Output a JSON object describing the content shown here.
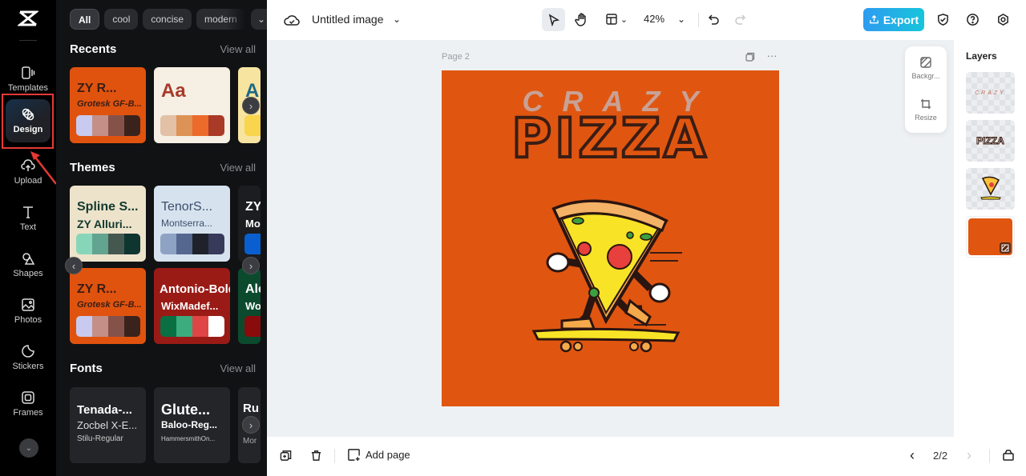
{
  "rail": {
    "items": [
      {
        "label": "Templates",
        "icon": "templates-icon"
      },
      {
        "label": "Design",
        "icon": "design-icon",
        "active": true
      },
      {
        "label": "Upload",
        "icon": "upload-icon"
      },
      {
        "label": "Text",
        "icon": "text-icon"
      },
      {
        "label": "Shapes",
        "icon": "shapes-icon"
      },
      {
        "label": "Photos",
        "icon": "photos-icon"
      },
      {
        "label": "Stickers",
        "icon": "stickers-icon"
      },
      {
        "label": "Frames",
        "icon": "frames-icon"
      }
    ]
  },
  "panel": {
    "chips": [
      "All",
      "cool",
      "concise",
      "modern"
    ],
    "recents": {
      "title": "Recents",
      "view_all": "View all",
      "cards": [
        {
          "t1": "ZY R...",
          "t2": "Grotesk GF-B...",
          "bg": "#e0530f",
          "fg": "#3a1d14",
          "palette": [
            "#c8cbef",
            "#c48f86",
            "#85524a",
            "#3a231d"
          ]
        },
        {
          "t1": "Aa",
          "bg": "#f5efe4",
          "fg": "#a83a2a",
          "palette": [
            "#e2c1a6",
            "#dd9256",
            "#ec6a2a",
            "#a93a27"
          ]
        },
        {
          "t1": "A",
          "bg": "#f8e4a1",
          "fg": "#1e6a84",
          "palette": [
            "#f9d44d"
          ]
        }
      ]
    },
    "themes": {
      "title": "Themes",
      "view_all": "View all",
      "cards": [
        {
          "t1": "Spline S...",
          "t2": "ZY Alluri...",
          "bg": "#ede3cb",
          "fg": "#12392f",
          "palette": [
            "#88d6b9",
            "#62a48f",
            "#45584f",
            "#0f3531"
          ]
        },
        {
          "t1": "TenorS...",
          "t2": "Montserra...",
          "bg": "#d6e3ef",
          "fg": "#3d4e6b",
          "palette": [
            "#8ea3c4",
            "#56678f",
            "#20222b",
            "#383a5a"
          ]
        },
        {
          "t1": "ZY",
          "t2": "Mo",
          "bg": "#1b1d20",
          "fg": "#ffffff",
          "palette": [
            "#0a5fd0"
          ]
        },
        {
          "t1": "ZY R...",
          "t2": "Grotesk GF-B...",
          "bg": "#e0530f",
          "fg": "#3a1d14",
          "palette": [
            "#c8cbef",
            "#c48f86",
            "#85524a",
            "#3a231d"
          ]
        },
        {
          "t1": "Antonio-Bold",
          "t2": "WixMadef...",
          "bg": "#9a1b16",
          "fg": "#ffffff",
          "palette": [
            "#0b6f44",
            "#3bac7e",
            "#e04546",
            "#ffffff"
          ]
        },
        {
          "t1": "Ale",
          "t2": "Wo",
          "bg": "#0c4a2e",
          "fg": "#ffffff",
          "palette": [
            "#8a0b0b"
          ]
        }
      ]
    },
    "fonts": {
      "title": "Fonts",
      "view_all": "View all",
      "cards": [
        {
          "t1": "Tenada-...",
          "t2": "Zocbel X-E...",
          "t3": "Stilu-Regular"
        },
        {
          "t1": "Glute...",
          "t2": "Baloo-Reg...",
          "t3": "HammersmithOn..."
        },
        {
          "t1": "Ru",
          "t3": "Mor"
        }
      ]
    }
  },
  "topbar": {
    "title": "Untitled image",
    "zoom": "42%",
    "export_label": "Export"
  },
  "canvas": {
    "page_label": "Page 2",
    "artboard_bg": "#e05610",
    "crazy_text": "CRAZY",
    "pizza_text": "PIZZA"
  },
  "float_tools": {
    "background_label": "Backgr...",
    "resize_label": "Resize"
  },
  "layers": {
    "title": "Layers",
    "items": [
      "CRAZY text layer",
      "PIZZA text layer",
      "pizza illustration layer",
      "background layer"
    ]
  },
  "bottombar": {
    "add_page": "Add page",
    "page_indicator": "2/2"
  },
  "colors": {
    "accent_red": "#e53935",
    "export_start": "#2e9bf0",
    "export_end": "#16c5dc"
  }
}
